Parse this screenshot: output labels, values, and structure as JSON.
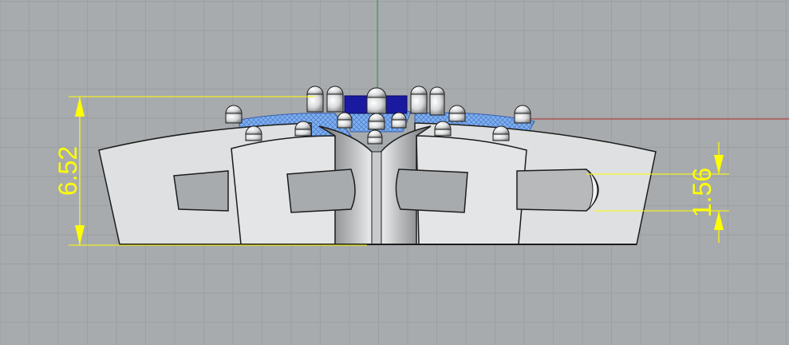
{
  "viewport": {
    "view": "Front",
    "background_color": "#a8abae",
    "grid_color": "#9c9fa2",
    "axis_x_color": "#b33030",
    "axis_y_color": "#2e9a2e"
  },
  "model": {
    "description_icon": "ring-model-icon",
    "body_color": "#e2e3e4",
    "shade_color": "#6e7072",
    "stone_color": "#7fb0ef",
    "center_stone_color": "#1a1aa0"
  },
  "dimensions": {
    "color": "#ffff00",
    "height": "6.52",
    "hole": "1.56"
  }
}
